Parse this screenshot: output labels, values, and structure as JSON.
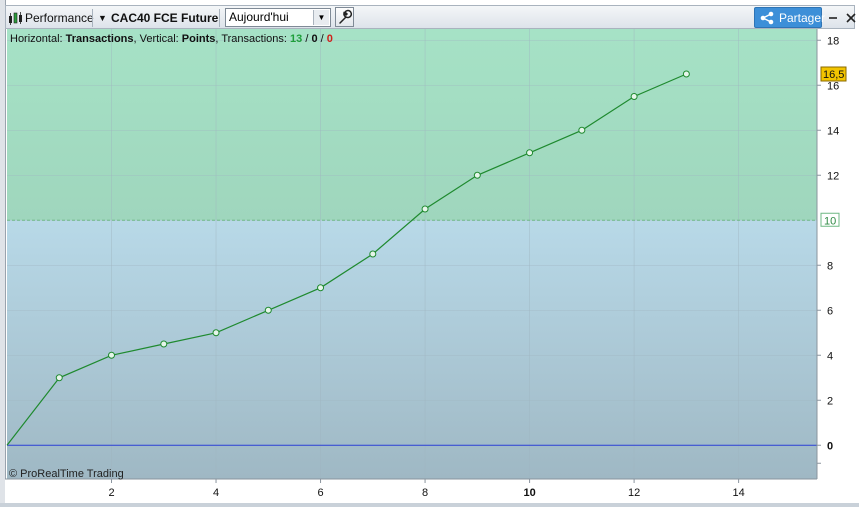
{
  "toolbar": {
    "indicator_label": "Performance",
    "instrument_label": "CAC40 FCE Future",
    "period_select": {
      "value": "Aujourd'hui"
    },
    "share_label": "Partager"
  },
  "chart_header": {
    "horizontal_prefix": "Horizontal: ",
    "horizontal_value": "Transactions",
    "vertical_prefix": ", Vertical: ",
    "vertical_value": "Points",
    "transactions_prefix": ", Transactions: ",
    "transactions_total": "13",
    "sep1": " / ",
    "transactions_mid": "0",
    "sep2": " / ",
    "transactions_last": "0"
  },
  "copyright": "© ProRealTime Trading",
  "colors": {
    "upper_zone": "#a3e0c3",
    "lower_zone": "#b2d3e3",
    "line": "#1f8a2f",
    "zero_line": "#2b3fd6",
    "threshold_line": "#6fb884",
    "current_badge": "#f2c400"
  },
  "chart_data": {
    "type": "line",
    "x": [
      0,
      1,
      2,
      3,
      4,
      5,
      6,
      7,
      8,
      9,
      10,
      11,
      12,
      13
    ],
    "series": [
      {
        "values": [
          0,
          3,
          4,
          4.5,
          5,
          6,
          7,
          8.5,
          10.5,
          12,
          13,
          14,
          15.5,
          16.5
        ]
      }
    ],
    "xlim": [
      0,
      15.5
    ],
    "ylim": [
      -1.5,
      18.5
    ],
    "x_ticks": [
      "2",
      "4",
      "6",
      "8",
      "10",
      "12",
      "14"
    ],
    "y_ticks": [
      "-0",
      "0",
      "2",
      "4",
      "6",
      "8",
      "10",
      "12",
      "14",
      "16",
      "18"
    ],
    "threshold": {
      "value": 10,
      "label": "10"
    },
    "current_value_label": "16,5",
    "grid": true
  }
}
